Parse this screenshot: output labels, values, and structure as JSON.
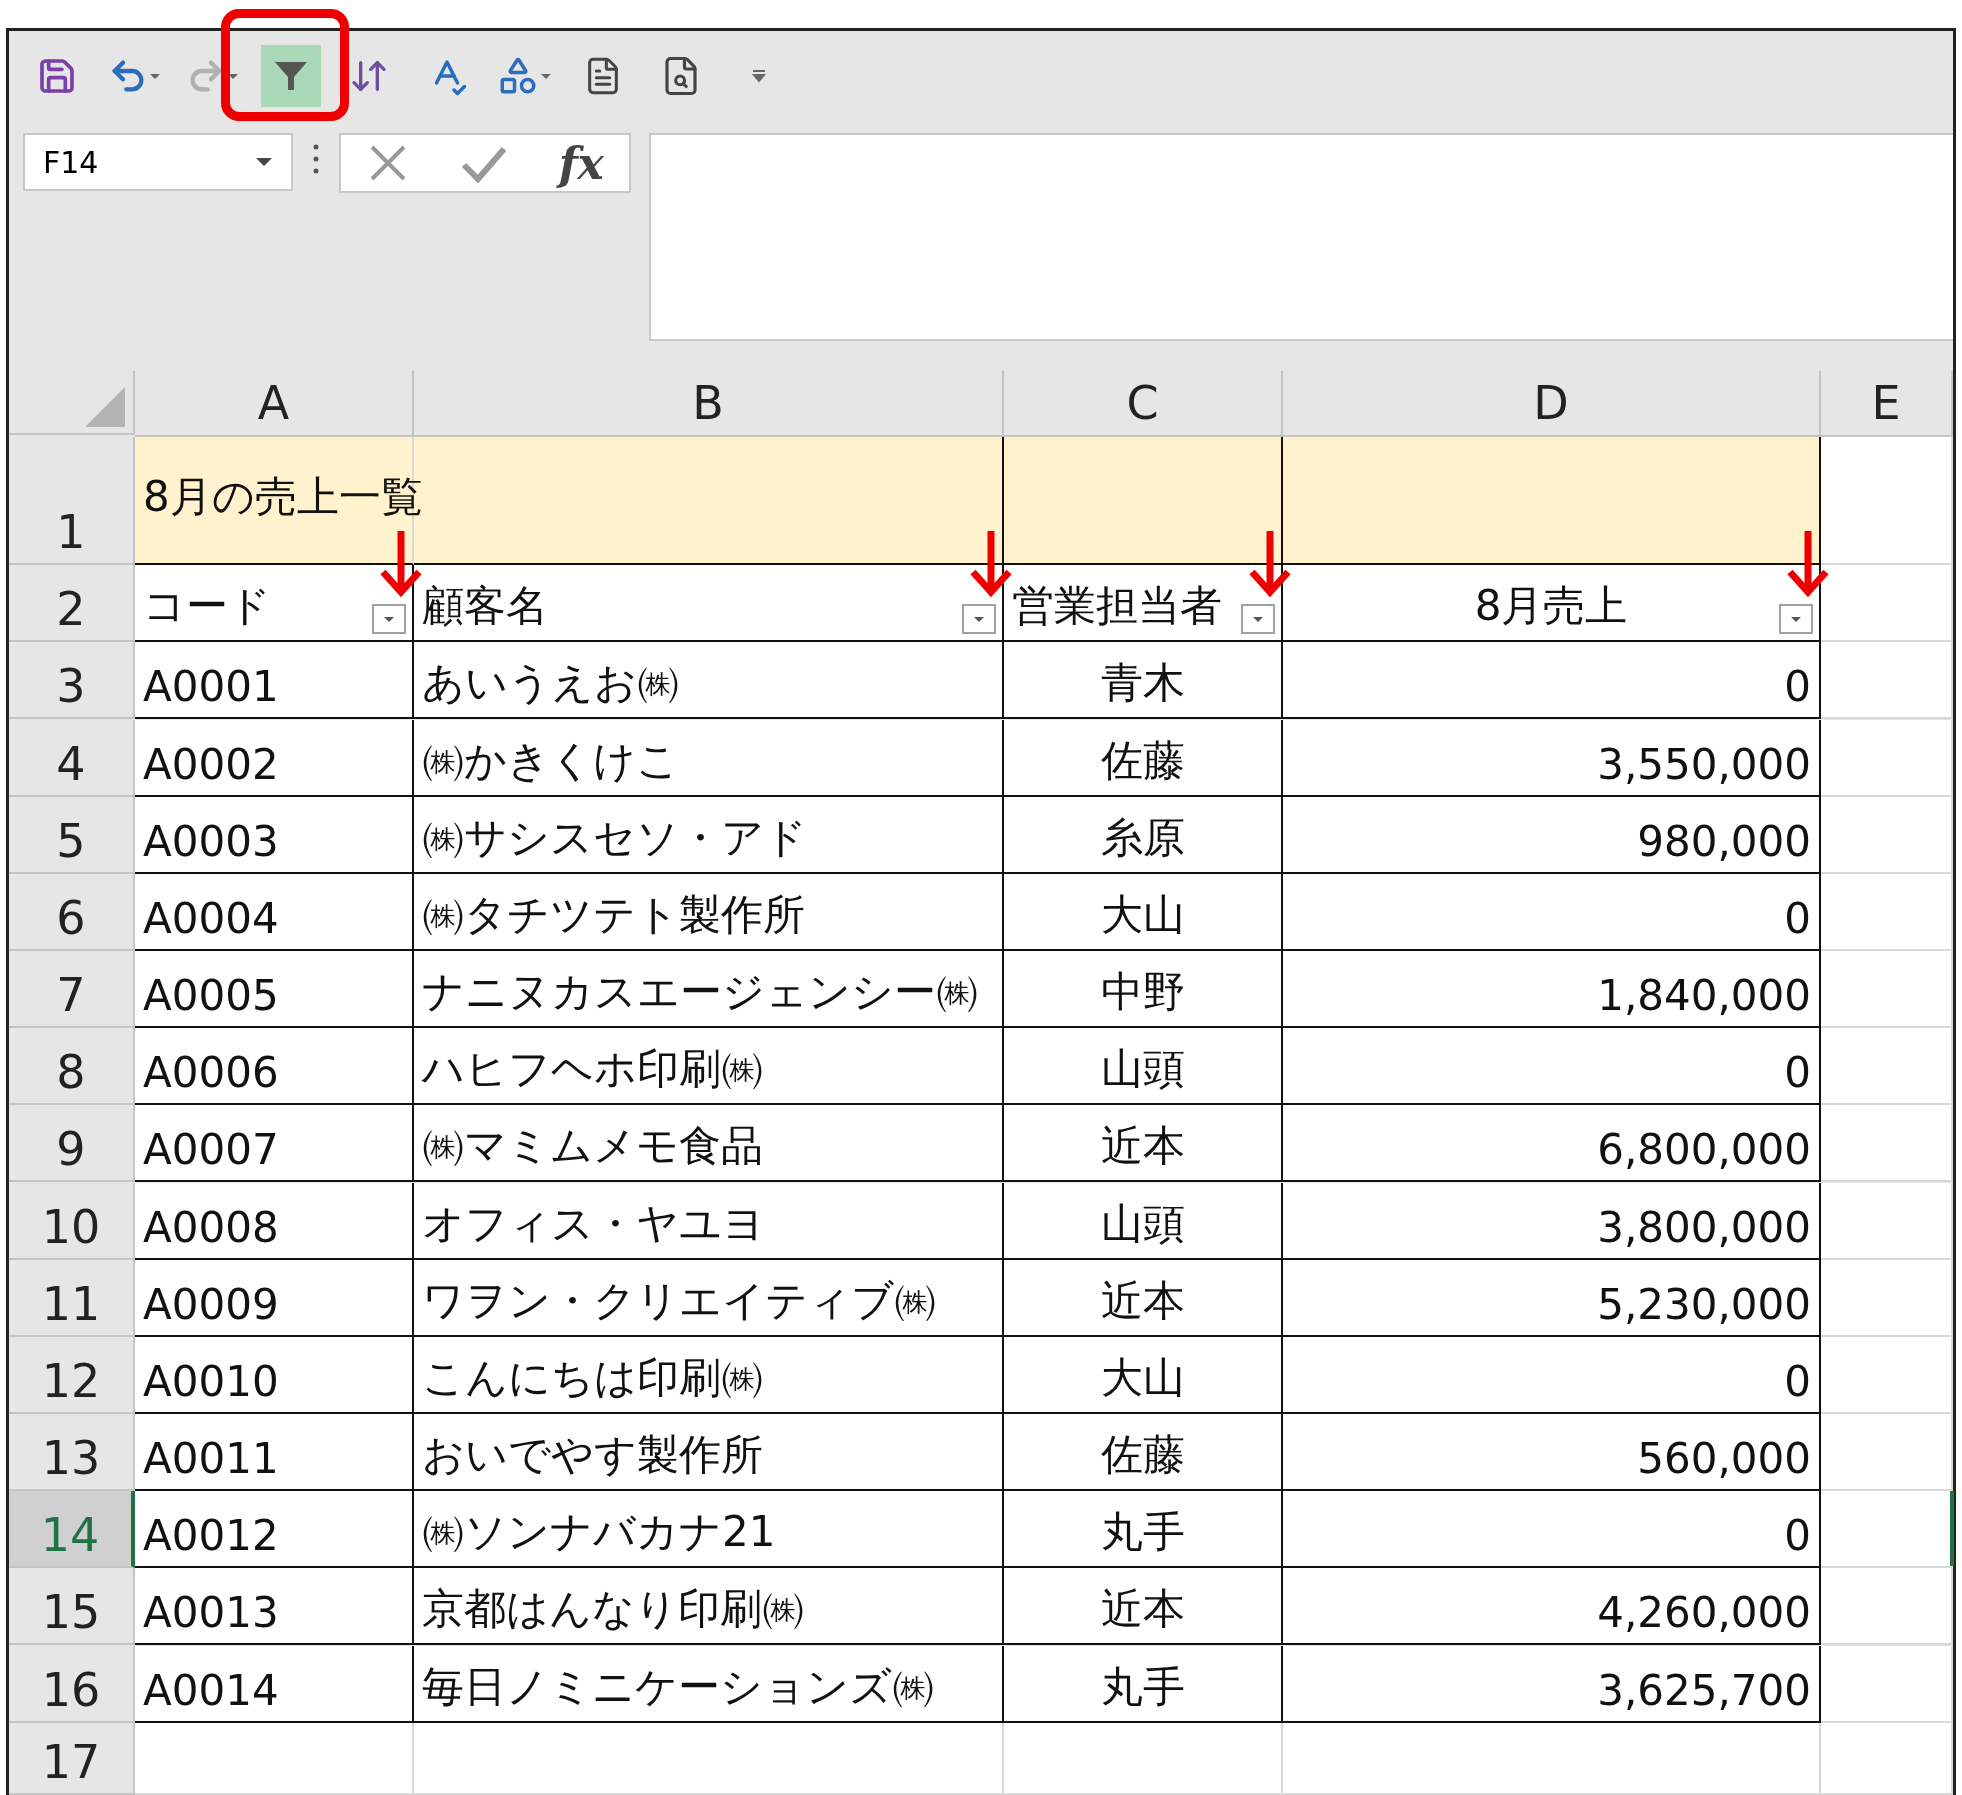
{
  "quick_access": {
    "filter_on": true,
    "filter_highlighted": true
  },
  "name_box": {
    "value": "F14"
  },
  "formula_bar": {
    "function_label": "fx"
  },
  "columns": [
    {
      "label": "A"
    },
    {
      "label": "B"
    },
    {
      "label": "C"
    },
    {
      "label": "D"
    },
    {
      "label": "E"
    }
  ],
  "rows": [
    {
      "number": "1",
      "selected": false,
      "kind": "title",
      "cells": [
        "8月の売上一覧"
      ]
    },
    {
      "number": "2",
      "selected": false,
      "kind": "header",
      "cells": [
        {
          "text": "コード",
          "filter": true,
          "centered": false
        },
        {
          "text": "顧客名",
          "filter": true,
          "centered": false
        },
        {
          "text": "営業担当者",
          "filter": true,
          "centered": false
        },
        {
          "text": "8月売上",
          "filter": true,
          "centered": true
        }
      ]
    },
    {
      "number": "3",
      "selected": false,
      "kind": "data",
      "cells": [
        "A0001",
        "あいうえお㈱",
        "青木",
        "0"
      ]
    },
    {
      "number": "4",
      "selected": false,
      "kind": "data",
      "cells": [
        "A0002",
        "㈱かきくけこ",
        "佐藤",
        "3,550,000"
      ]
    },
    {
      "number": "5",
      "selected": false,
      "kind": "data",
      "cells": [
        "A0003",
        "㈱サシスセソ・アド",
        "糸原",
        "980,000"
      ]
    },
    {
      "number": "6",
      "selected": false,
      "kind": "data",
      "cells": [
        "A0004",
        "㈱タチツテト製作所",
        "大山",
        "0"
      ]
    },
    {
      "number": "7",
      "selected": false,
      "kind": "data",
      "cells": [
        "A0005",
        "ナニヌカスエージェンシー㈱",
        "中野",
        "1,840,000"
      ]
    },
    {
      "number": "8",
      "selected": false,
      "kind": "data",
      "cells": [
        "A0006",
        "ハヒフヘホ印刷㈱",
        "山頭",
        "0"
      ]
    },
    {
      "number": "9",
      "selected": false,
      "kind": "data",
      "cells": [
        "A0007",
        "㈱マミムメモ食品",
        "近本",
        "6,800,000"
      ]
    },
    {
      "number": "10",
      "selected": false,
      "kind": "data",
      "cells": [
        "A0008",
        "オフィス・ヤユヨ",
        "山頭",
        "3,800,000"
      ]
    },
    {
      "number": "11",
      "selected": false,
      "kind": "data",
      "cells": [
        "A0009",
        "ワヲン・クリエイティブ㈱",
        "近本",
        "5,230,000"
      ]
    },
    {
      "number": "12",
      "selected": false,
      "kind": "data",
      "cells": [
        "A0010",
        "こんにちは印刷㈱",
        "大山",
        "0"
      ]
    },
    {
      "number": "13",
      "selected": false,
      "kind": "data",
      "cells": [
        "A0011",
        "おいでやす製作所",
        "佐藤",
        "560,000"
      ]
    },
    {
      "number": "14",
      "selected": true,
      "kind": "data",
      "cells": [
        "A0012",
        "㈱ソンナバカナ21",
        "丸手",
        "0"
      ]
    },
    {
      "number": "15",
      "selected": false,
      "kind": "data",
      "cells": [
        "A0013",
        "京都はんなり印刷㈱",
        "近本",
        "4,260,000"
      ]
    },
    {
      "number": "16",
      "selected": false,
      "kind": "data",
      "cells": [
        "A0014",
        "毎日ノミニケーションズ㈱",
        "丸手",
        "3,625,700"
      ]
    },
    {
      "number": "17",
      "selected": false,
      "kind": "empty",
      "cells": []
    }
  ]
}
